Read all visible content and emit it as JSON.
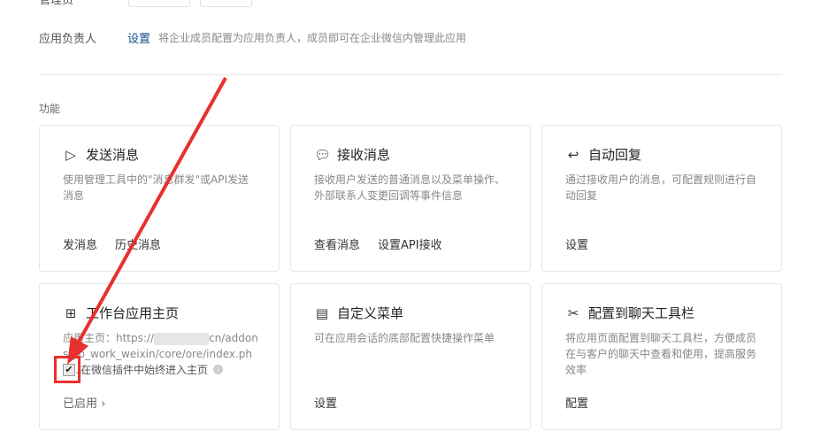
{
  "top": {
    "admin_label": "管理员"
  },
  "owner": {
    "label": "应用负责人",
    "link": "设置",
    "desc": "将企业成员配置为应用负责人，成员即可在企业微信内管理此应用"
  },
  "section_title": "功能",
  "cards": [
    {
      "icon": "send-icon",
      "title": "发送消息",
      "desc": "使用管理工具中的\"消息群发\"或API发送消息",
      "actions": [
        "发消息",
        "历史消息"
      ]
    },
    {
      "icon": "chat-icon",
      "title": "接收消息",
      "desc": "接收用户发送的普通消息以及菜单操作、外部联系人变更回调等事件信息",
      "actions": [
        "查看消息",
        "设置API接收"
      ]
    },
    {
      "icon": "reply-icon",
      "title": "自动回复",
      "desc": "通过接收用户的消息，可配置规则进行自动回复",
      "actions": [
        "设置"
      ]
    },
    {
      "icon": "grid-icon",
      "title": "工作台应用主页",
      "desc_prefix": "应用主页：https://",
      "desc_suffix": "cn/addons/yb_work_weixin/core/ore/index.php?…",
      "checkbox_label": "在微信插件中始终进入主页",
      "checkbox_checked": true,
      "actions": [
        "已启用 ›"
      ]
    },
    {
      "icon": "menu-icon",
      "title": "自定义菜单",
      "desc": "可在应用会话的底部配置快捷操作菜单",
      "actions": [
        "设置"
      ]
    },
    {
      "icon": "tools-icon",
      "title": "配置到聊天工具栏",
      "desc": "将应用页面配置到聊天工具栏，方便成员在与客户的聊天中查看和使用，提高服务效率",
      "actions": [
        "配置"
      ]
    }
  ],
  "colors": {
    "link": "#1a4e8c",
    "annotation": "#e8302c"
  }
}
